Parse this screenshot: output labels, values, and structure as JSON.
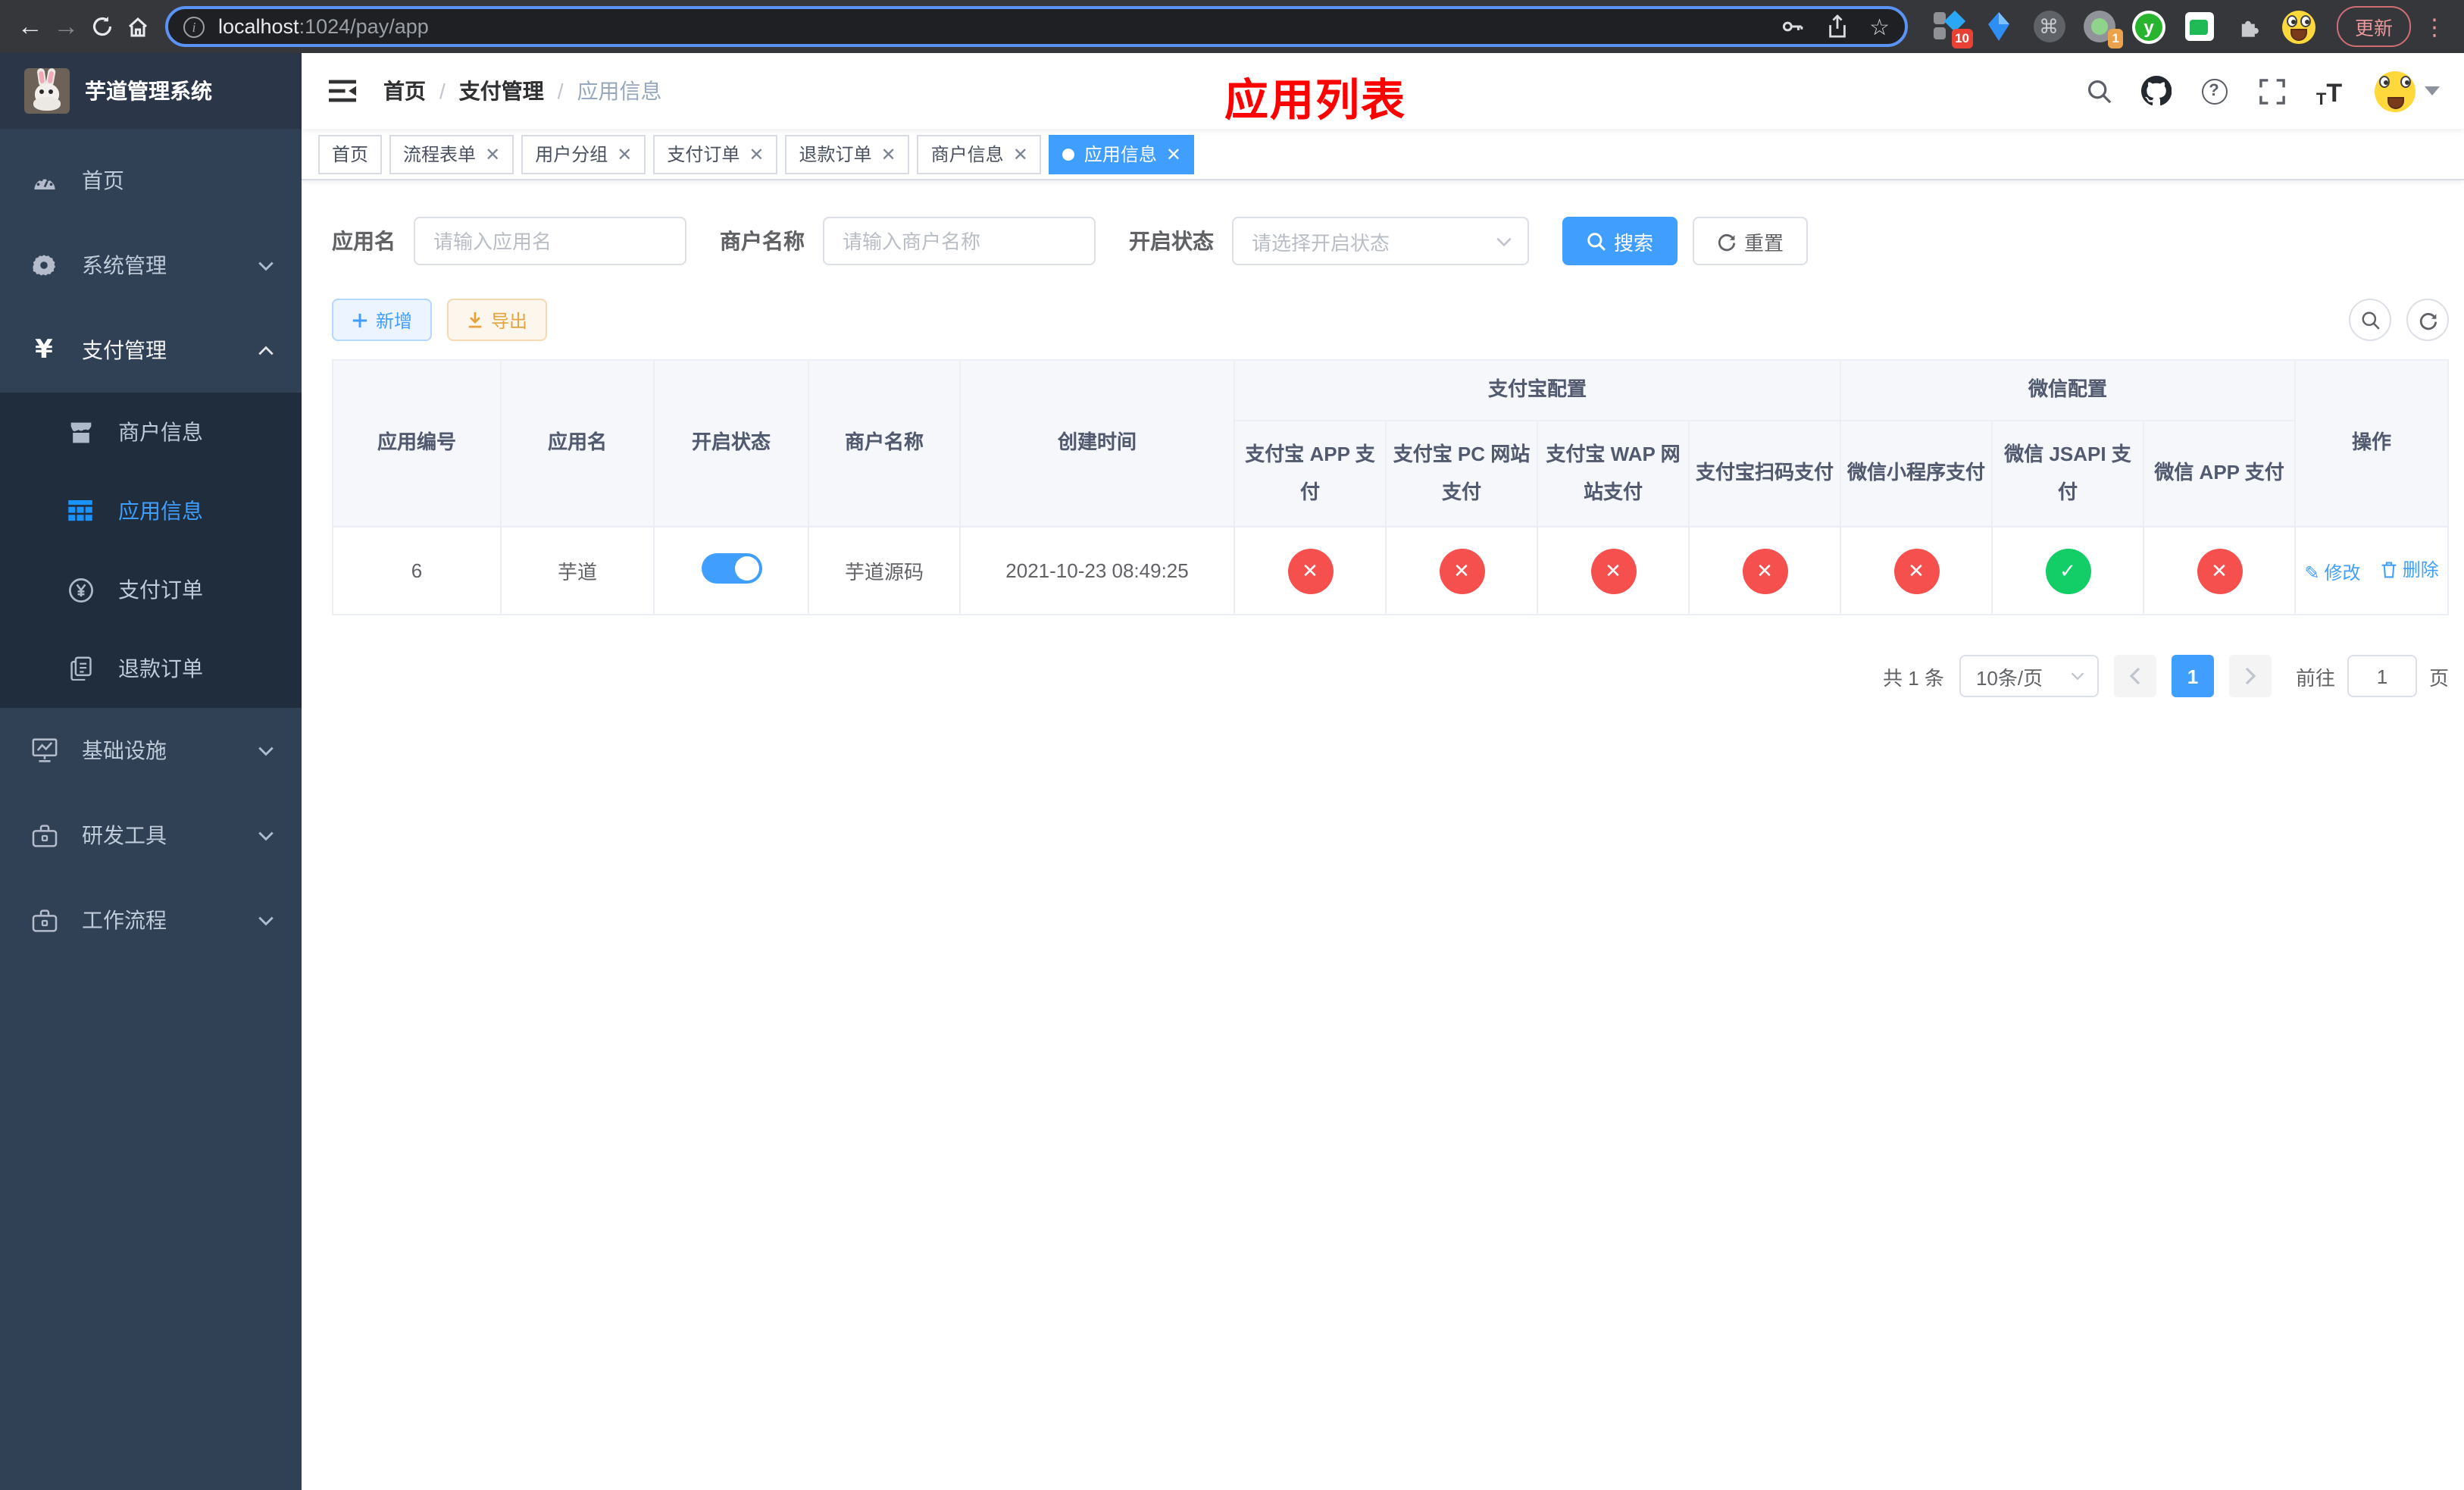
{
  "browser": {
    "url": {
      "host": "localhost",
      "path": ":1024/pay/app"
    },
    "update_label": "更新",
    "ext_badges": {
      "first": "10",
      "second": "1"
    },
    "y_ext_letter": "y"
  },
  "sidebar": {
    "title": "芋道管理系统",
    "home": "首页",
    "system": "系统管理",
    "payment": "支付管理",
    "merchant_info": "商户信息",
    "app_info": "应用信息",
    "pay_order": "支付订单",
    "refund_order": "退款订单",
    "infra": "基础设施",
    "dev_tools": "研发工具",
    "workflow": "工作流程"
  },
  "header": {
    "breadcrumb": [
      "首页",
      "支付管理",
      "应用信息"
    ],
    "annotation": "应用列表"
  },
  "tabs": [
    {
      "label": "首页"
    },
    {
      "label": "流程表单"
    },
    {
      "label": "用户分组"
    },
    {
      "label": "支付订单"
    },
    {
      "label": "退款订单"
    },
    {
      "label": "商户信息"
    },
    {
      "label": "应用信息"
    }
  ],
  "filters": {
    "app_name": {
      "label": "应用名",
      "placeholder": "请输入应用名"
    },
    "merchant": {
      "label": "商户名称",
      "placeholder": "请输入商户名称"
    },
    "status": {
      "label": "开启状态",
      "placeholder": "请选择开启状态"
    },
    "search_label": "搜索",
    "reset_label": "重置"
  },
  "toolbar": {
    "add_label": "新增",
    "export_label": "导出"
  },
  "table": {
    "groups": {
      "alipay": "支付宝配置",
      "wechat": "微信配置"
    },
    "columns": [
      "应用编号",
      "应用名",
      "开启状态",
      "商户名称",
      "创建时间",
      "支付宝 APP 支付",
      "支付宝 PC 网站支付",
      "支付宝 WAP 网站支付",
      "支付宝扫码支付",
      "微信小程序支付",
      "微信 JSAPI 支付",
      "微信 APP 支付",
      "操作"
    ],
    "row": {
      "id": "6",
      "name": "芋道",
      "enabled": true,
      "merchant": "芋道源码",
      "created_at": "2021-10-23 08:49:25",
      "statuses": [
        "fail",
        "fail",
        "fail",
        "fail",
        "fail",
        "ok",
        "fail"
      ],
      "edit_label": "修改",
      "delete_label": "删除"
    }
  },
  "pagination": {
    "total": "共 1 条",
    "page_size": "10条/页",
    "current": "1",
    "goto_prefix": "前往",
    "goto_value": "1",
    "goto_suffix": "页"
  },
  "colors": {
    "accent": "#409eff",
    "danger": "#f5504e",
    "success": "#13ce66",
    "warning": "#e6a23c",
    "annotation": "#ff0000"
  }
}
